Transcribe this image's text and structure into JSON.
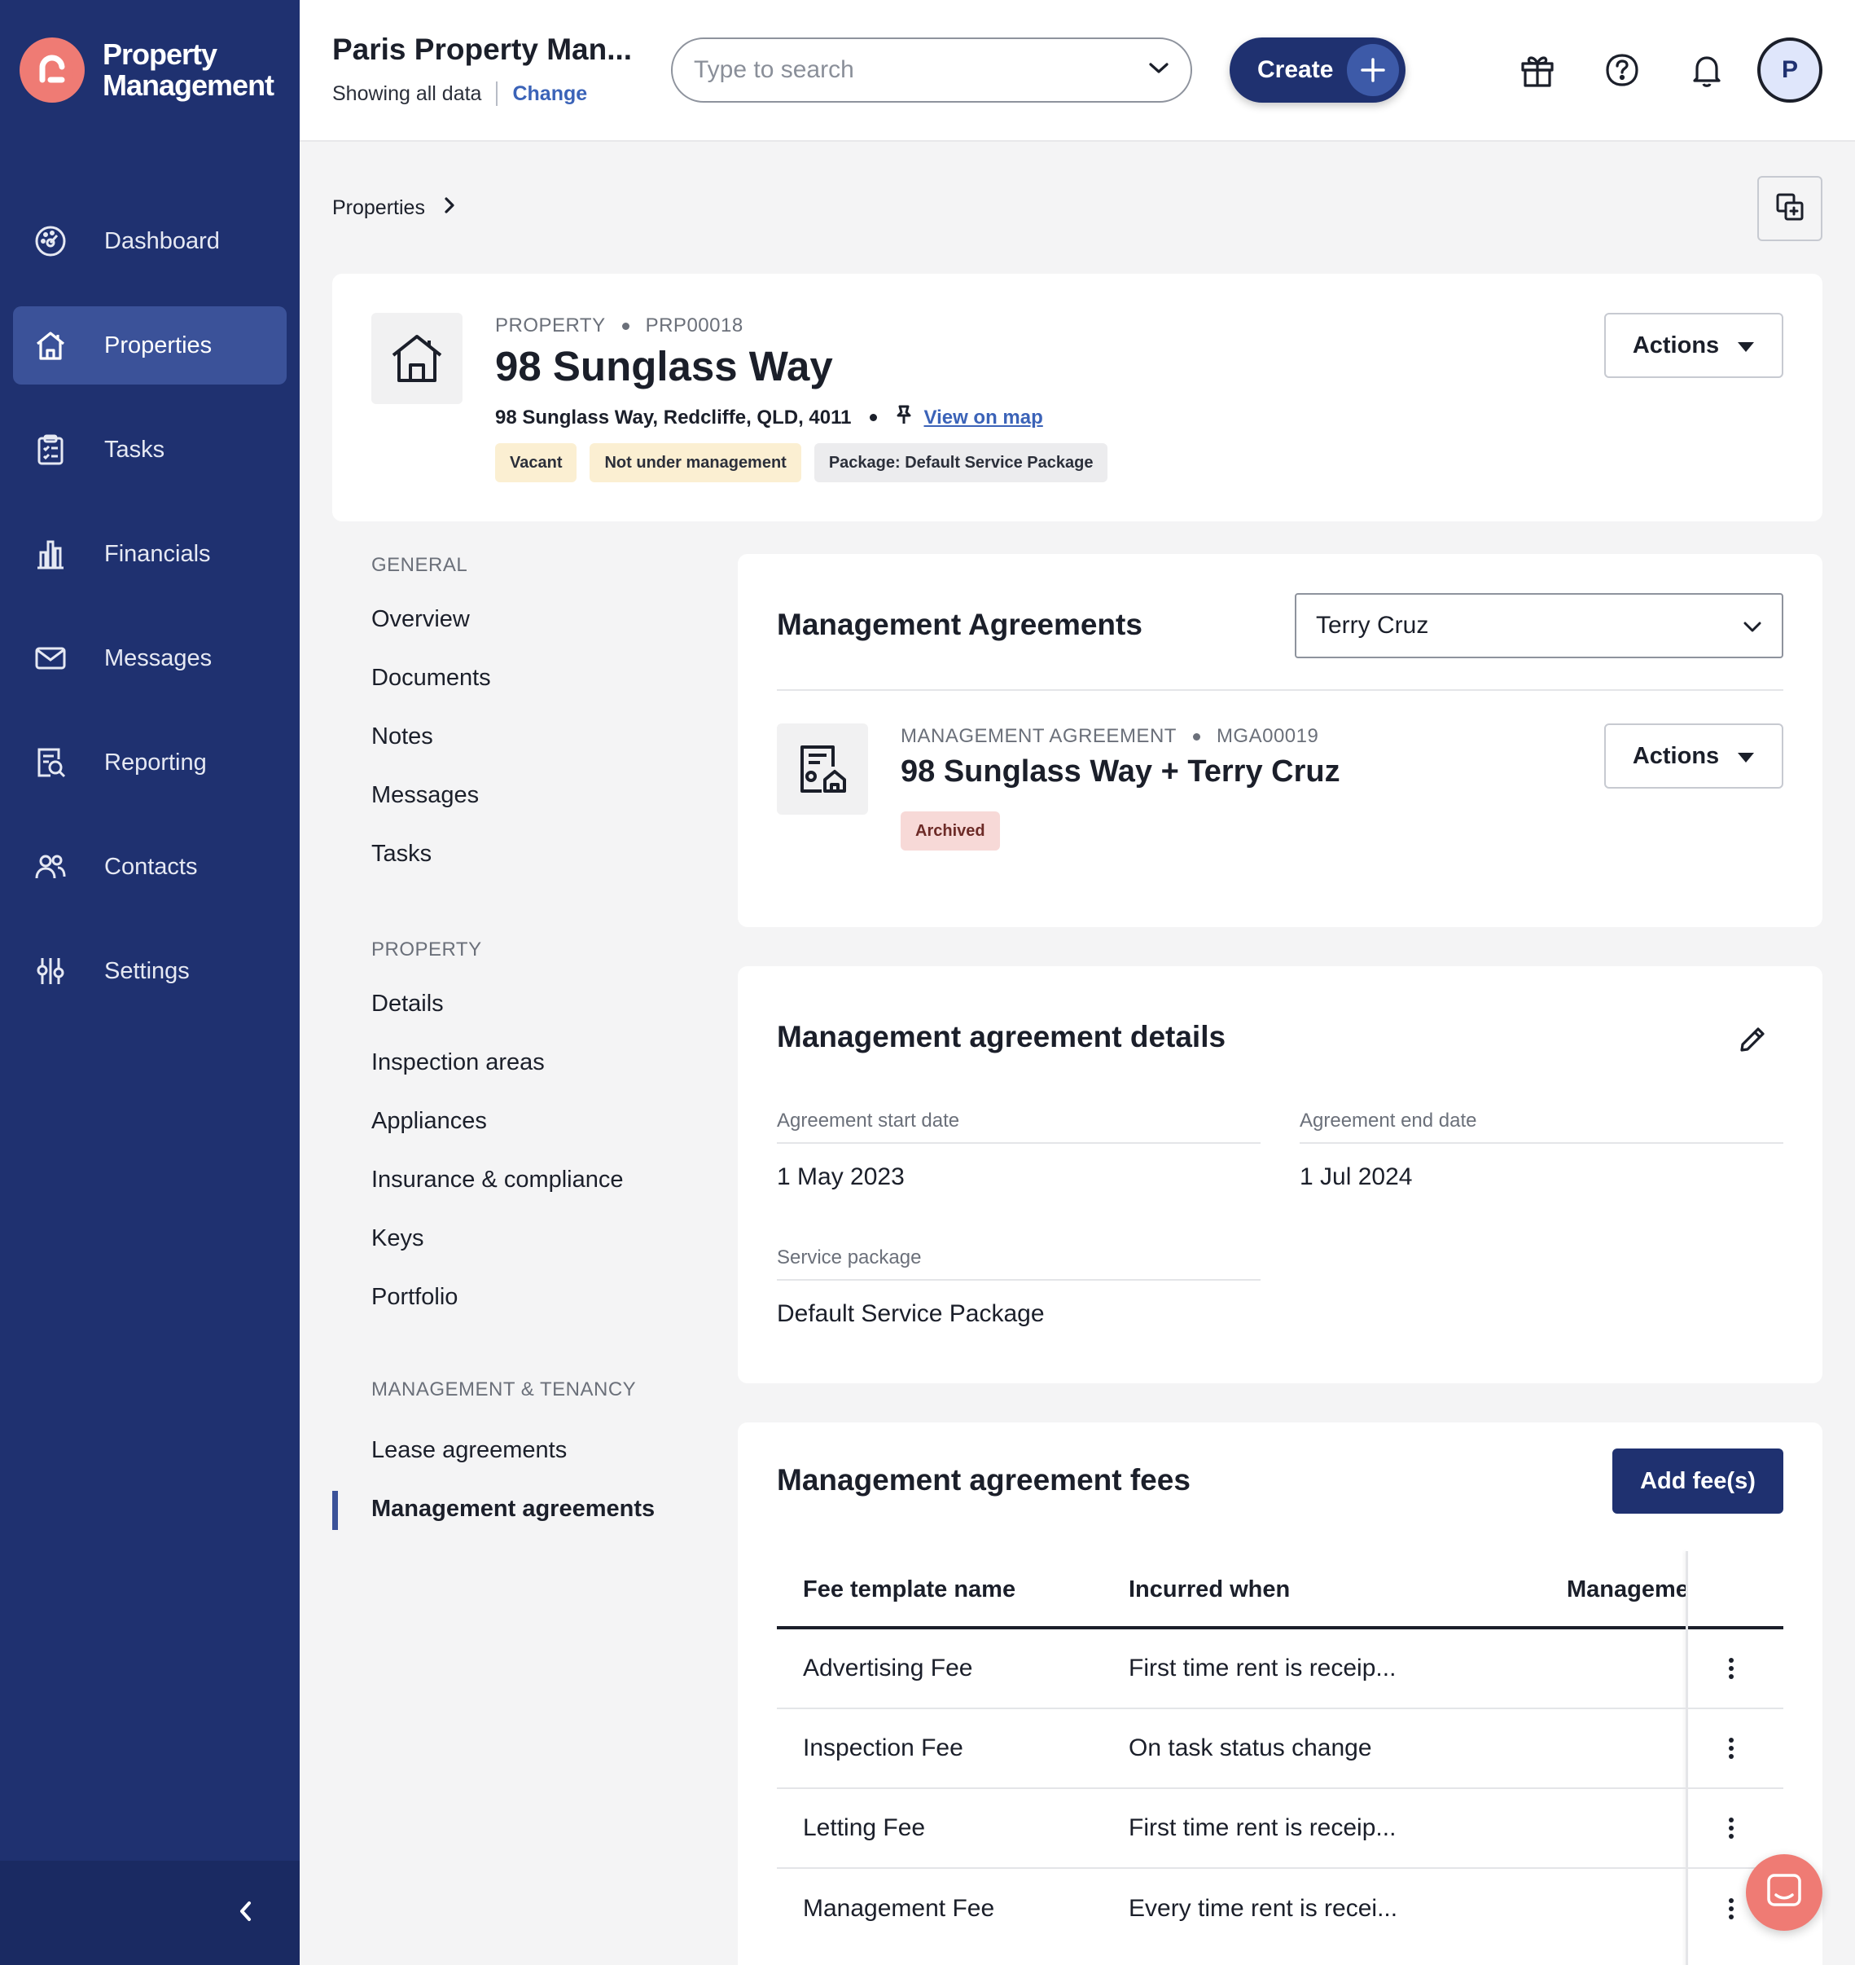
{
  "app": {
    "logo_line1": "Property",
    "logo_line2": "Management",
    "accent": "#1f3170",
    "brand": "#ef7b74"
  },
  "sidebar": {
    "items": [
      {
        "label": "Dashboard",
        "icon": "dashboard-icon"
      },
      {
        "label": "Properties",
        "icon": "home-icon",
        "active": true
      },
      {
        "label": "Tasks",
        "icon": "clipboard-icon"
      },
      {
        "label": "Financials",
        "icon": "bar-chart-icon"
      },
      {
        "label": "Messages",
        "icon": "mail-icon"
      },
      {
        "label": "Reporting",
        "icon": "report-search-icon"
      },
      {
        "label": "Contacts",
        "icon": "users-icon"
      },
      {
        "label": "Settings",
        "icon": "sliders-icon"
      }
    ],
    "collapse_icon": "chevron-left-icon"
  },
  "header": {
    "org_title": "Paris Property Man...",
    "org_sub": "Showing all data",
    "change_label": "Change",
    "search_placeholder": "Type to search",
    "create_label": "Create",
    "avatar_initial": "P"
  },
  "breadcrumb": {
    "items": [
      "Properties"
    ]
  },
  "property": {
    "type_label": "PROPERTY",
    "id": "PRP00018",
    "title": "98 Sunglass Way",
    "address": "98 Sunglass Way, Redcliffe, QLD, 4011",
    "map_link": "View on map",
    "tags": [
      "Vacant",
      "Not under management",
      "Package: Default Service Package"
    ],
    "actions_label": "Actions"
  },
  "subnav": {
    "groups": [
      {
        "title": "GENERAL",
        "items": [
          "Overview",
          "Documents",
          "Notes",
          "Messages",
          "Tasks"
        ]
      },
      {
        "title": "PROPERTY",
        "items": [
          "Details",
          "Inspection areas",
          "Appliances",
          "Insurance & compliance",
          "Keys",
          "Portfolio"
        ]
      },
      {
        "title": "MANAGEMENT & TENANCY",
        "items": [
          "Lease agreements",
          "Management agreements"
        ]
      }
    ],
    "active": "Management agreements"
  },
  "agreements": {
    "title": "Management Agreements",
    "owner_select": "Terry Cruz",
    "type_label": "MANAGEMENT AGREEMENT",
    "id": "MGA00019",
    "agreement_title": "98 Sunglass Way + Terry Cruz",
    "status": "Archived",
    "actions_label": "Actions"
  },
  "details": {
    "title": "Management agreement details",
    "start_label": "Agreement start date",
    "start_value": "1 May 2023",
    "end_label": "Agreement end date",
    "end_value": "1 Jul 2024",
    "package_label": "Service package",
    "package_value": "Default Service Package"
  },
  "fees": {
    "title": "Management agreement fees",
    "add_label": "Add fee(s)",
    "columns": [
      "Fee template name",
      "Incurred when",
      "Manageme"
    ],
    "rows": [
      {
        "name": "Advertising Fee",
        "when": "First time rent is receip..."
      },
      {
        "name": "Inspection Fee",
        "when": "On task status change"
      },
      {
        "name": "Letting Fee",
        "when": "First time rent is receip..."
      },
      {
        "name": "Management Fee",
        "when": "Every time rent is recei..."
      }
    ]
  }
}
